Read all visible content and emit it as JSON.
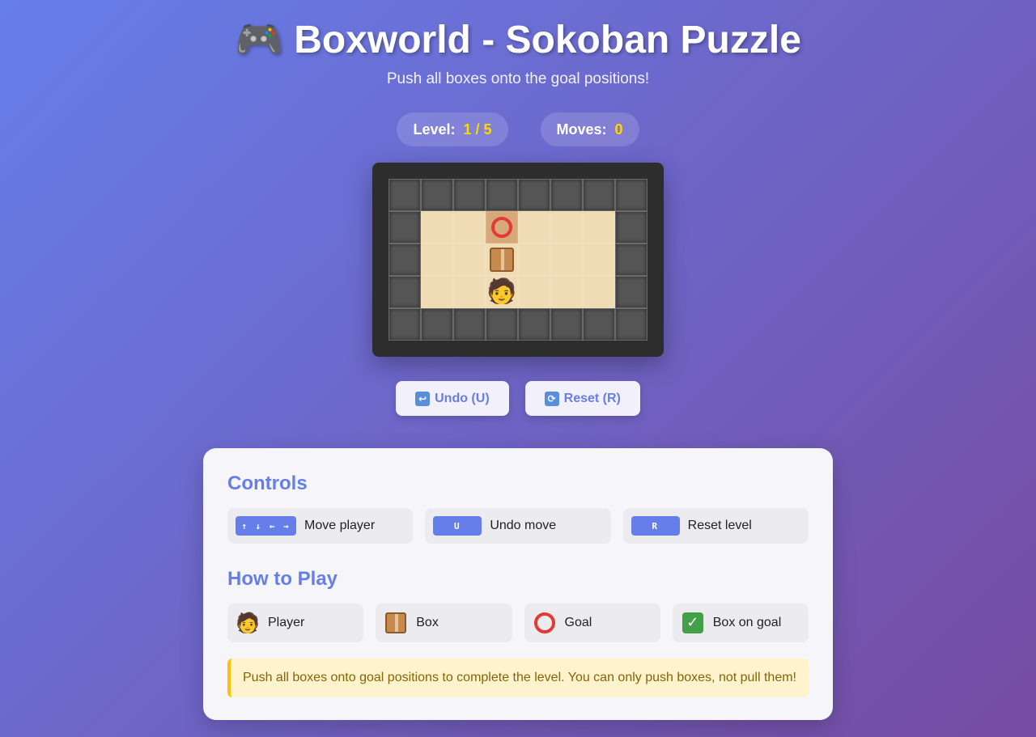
{
  "header": {
    "title_icon": "game-controller-icon",
    "title_emoji": "🎮",
    "title": "Boxworld - Sokoban Puzzle",
    "subtitle": "Push all boxes onto the goal positions!"
  },
  "stats": {
    "level_label": "Level:",
    "level_value": "1 / 5",
    "moves_label": "Moves:",
    "moves_value": "0"
  },
  "board": {
    "rows": [
      "WWWWWWWW",
      "W..G...W",
      "W..B...W",
      "W..P...W",
      "WWWWWWWW"
    ],
    "legend": {
      "W": "wall",
      ".": "floor",
      "G": "goal",
      "B": "box",
      "P": "player"
    }
  },
  "buttons": {
    "undo_label": "Undo (U)",
    "undo_icon": "undo-arrow-icon",
    "reset_label": "Reset (R)",
    "reset_icon": "reset-cycle-icon"
  },
  "controls": {
    "heading": "Controls",
    "items": [
      {
        "key": "↑ ↓ ← →",
        "label": "Move player"
      },
      {
        "key": "U",
        "label": "Undo move"
      },
      {
        "key": "R",
        "label": "Reset level"
      }
    ]
  },
  "howto": {
    "heading": "How to Play",
    "items": [
      {
        "icon": "player-icon",
        "label": "Player"
      },
      {
        "icon": "box-icon",
        "label": "Box"
      },
      {
        "icon": "goal-icon",
        "label": "Goal"
      },
      {
        "icon": "box-on-goal-icon",
        "label": "Box on goal"
      }
    ]
  },
  "tip": "Push all boxes onto goal positions to complete the level. You can only push boxes, not pull them!",
  "colors": {
    "accent": "#667eea",
    "gradient_end": "#764ba2",
    "highlight": "#ffd700",
    "wall": "#555555",
    "floor": "#f0dcb4",
    "goal_cell": "#d7a878"
  }
}
